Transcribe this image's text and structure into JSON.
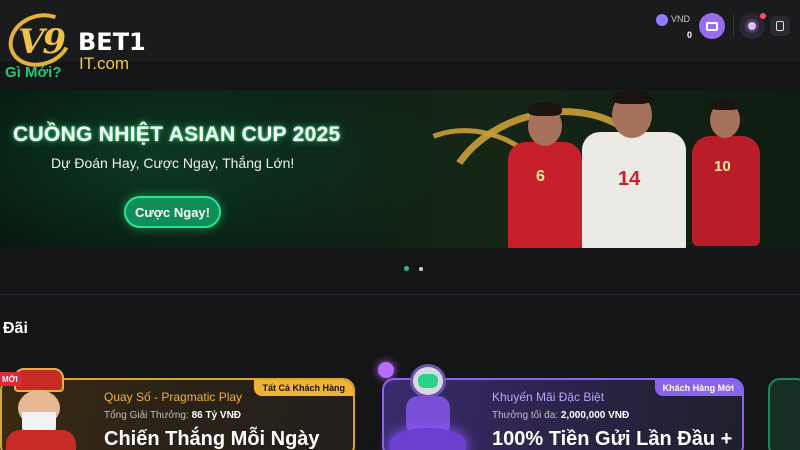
{
  "header": {
    "logo": {
      "mark": "V9",
      "name": "BET1",
      "domain": "IT.com"
    },
    "whats_new": "Gì Mới?",
    "balance": {
      "currency": "VND",
      "amount": "0"
    },
    "icons": [
      "wallet-icon",
      "avatar-icon",
      "menu-icon"
    ]
  },
  "banner": {
    "title": "CUỒNG NHIỆT ASIAN CUP 2025",
    "subtitle": "Dự Đoán Hay, Cược Ngay, Thắng Lớn!",
    "cta": "Cược Ngay!",
    "player_numbers": [
      "6",
      "14",
      "10"
    ]
  },
  "carousel": {
    "total": 2,
    "active": 0
  },
  "section": {
    "title": "Đãi"
  },
  "promos": [
    {
      "tag": "MỚI",
      "badge": "Tất Cả Khách Hàng",
      "category": "Quay Số - Pragmatic Play",
      "meta_label": "Tổng Giải Thưởng:",
      "meta_value": "86 Tỷ VNĐ",
      "headline": "Chiến Thắng Mỗi Ngày"
    },
    {
      "badge": "Khách Hàng Mới",
      "category": "Khuyến Mãi Đặc Biệt",
      "meta_label": "Thưởng tối đa:",
      "meta_value": "2,000,000 VNĐ",
      "headline": "100% Tiền Gửi Lần Đầu +"
    }
  ],
  "colors": {
    "background": "#141516",
    "accent_green": "#1ec97a",
    "gold": "#f1b335",
    "purple": "#8b63ef"
  }
}
